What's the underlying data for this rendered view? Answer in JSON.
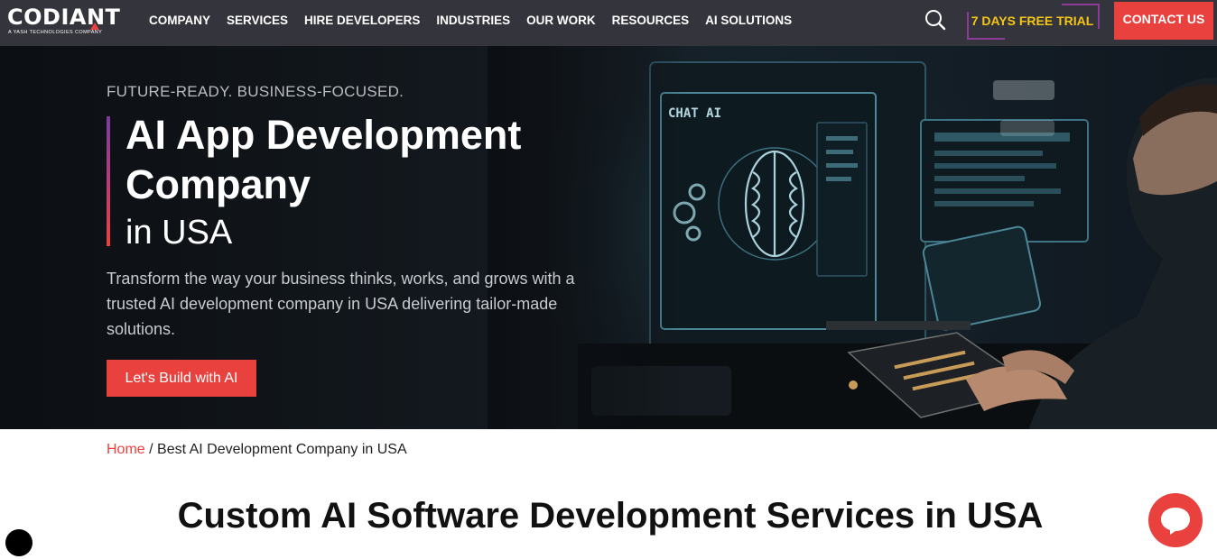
{
  "brand": {
    "name": "CODIANT",
    "tagline": "A YASH TECHNOLOGIES COMPANY",
    "accent_color": "#e8413e",
    "nav_bg": "#34343c",
    "trial_color": "#f5c518"
  },
  "nav": {
    "items": [
      "COMPANY",
      "SERVICES",
      "HIRE DEVELOPERS",
      "INDUSTRIES",
      "OUR WORK",
      "RESOURCES",
      "AI SOLUTIONS"
    ],
    "search_icon": "search-icon",
    "trial_label": "7 DAYS FREE TRIAL",
    "contact_label": "CONTACT US"
  },
  "hero": {
    "eyebrow": "FUTURE-READY. BUSINESS-FOCUSED.",
    "title_line1": "AI App Development",
    "title_line2": "Company",
    "title_line3": "in USA",
    "description": "Transform the way your business thinks, works, and grows with a trusted AI development company in USA delivering tailor-made solutions.",
    "cta_label": "Let's Build with AI",
    "screen_label": "CHAT AI"
  },
  "breadcrumb": {
    "home": "Home",
    "separator": " / ",
    "current": "Best AI Development Company in USA"
  },
  "section": {
    "title": "Custom AI Software Development Services in USA"
  },
  "widgets": {
    "chat_icon": "chat-bubble-icon",
    "floating_icon": "accessibility-icon"
  }
}
